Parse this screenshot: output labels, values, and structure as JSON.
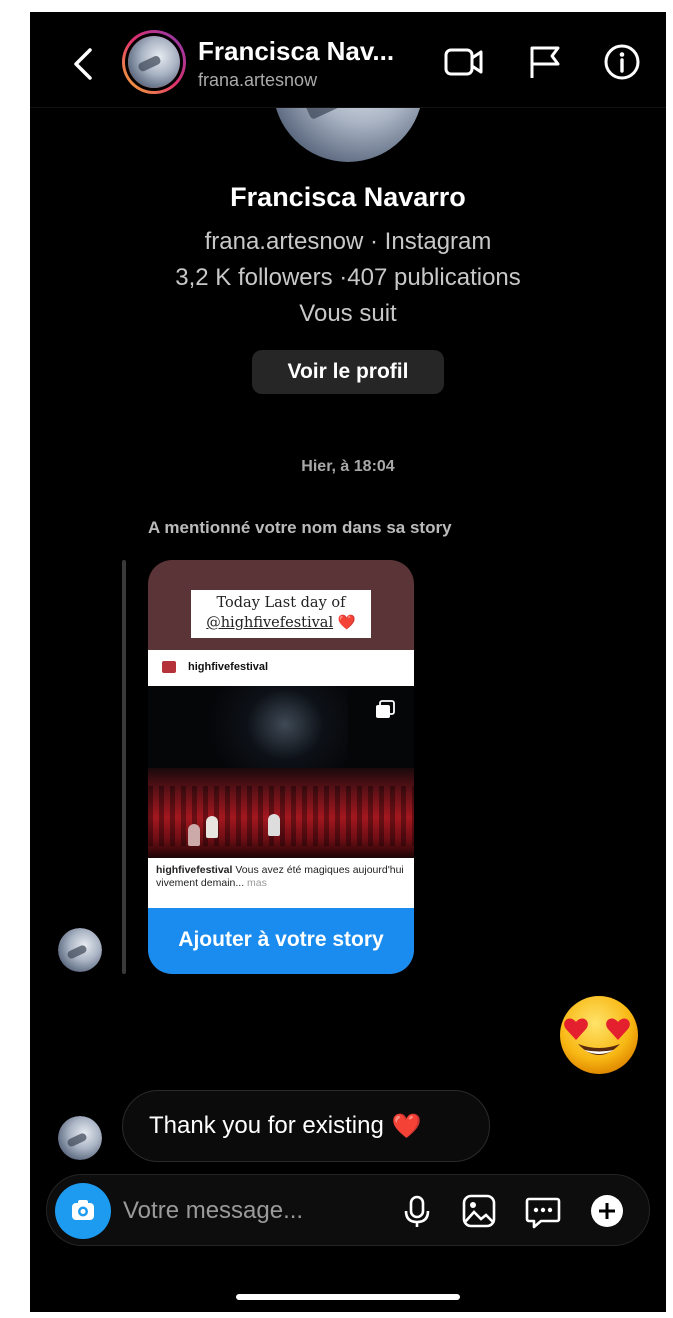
{
  "header": {
    "name": "Francisca Nav...",
    "handle": "frana.artesnow"
  },
  "profile": {
    "name": "Francisca Navarro",
    "handle_line": "frana.artesnow · Instagram",
    "stats_line": "3,2 K followers ·407 publications",
    "follow_status": "Vous suit",
    "view_profile_label": "Voir le profil"
  },
  "conversation": {
    "timestamp": "Hier, à 18:04",
    "mention_label": "A mentionné votre nom dans sa story",
    "story": {
      "caption_line1": "Today Last day of",
      "caption_mention": "@highfivefestival",
      "caption_heart": "❤️",
      "post_account": "highfivefestival",
      "post_caption_user": "highfivefestival",
      "post_caption_text": " Vous avez été magiques aujourd'hui vivement demain...",
      "post_caption_more": " mas",
      "add_to_story_label": "Ajouter à votre story"
    },
    "reply_emoji": "heart-eyes-emoji",
    "message_text": "Thank you for existing",
    "message_heart": "❤️"
  },
  "composer": {
    "placeholder": "Votre message..."
  },
  "colors": {
    "accent_blue": "#1d9bf0",
    "background": "#000000",
    "story_bg": "#5a3436"
  },
  "icons": [
    "back-chevron-icon",
    "video-call-icon",
    "flag-icon",
    "info-icon",
    "camera-icon",
    "microphone-icon",
    "gallery-icon",
    "sticker-chat-icon",
    "plus-icon"
  ]
}
